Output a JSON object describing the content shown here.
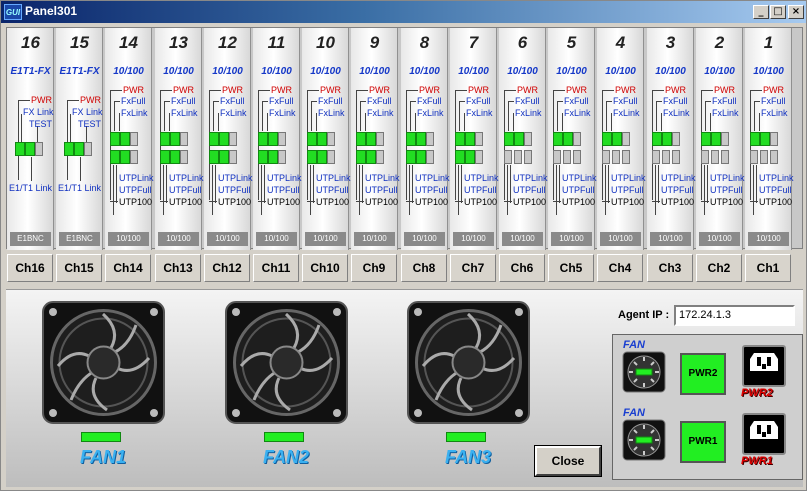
{
  "window": {
    "title": "Panel301",
    "icon_text": "GUI",
    "controls": [
      "_",
      "□",
      "×"
    ]
  },
  "channels": [
    {
      "num": "16",
      "type": "E1T1-FX",
      "kind": "e1",
      "lines": [
        "PWR",
        "FX Link",
        "TEST"
      ],
      "bottom": "E1/T1 Link",
      "foot": "E1BNC",
      "ch": "Ch16"
    },
    {
      "num": "15",
      "type": "E1T1-FX",
      "kind": "e1",
      "lines": [
        "PWR",
        "FX Link",
        "TEST"
      ],
      "bottom": "E1/T1 Link",
      "foot": "E1BNC",
      "ch": "Ch15"
    },
    {
      "num": "14",
      "type": "10/100",
      "kind": "eth",
      "lines": [
        "PWR",
        "FxFull",
        "FxLink",
        "UTPLink",
        "UTPFull",
        "UTP100"
      ],
      "foot": "10/100",
      "ch": "Ch14"
    },
    {
      "num": "13",
      "type": "10/100",
      "kind": "eth",
      "lines": [
        "PWR",
        "FxFull",
        "FxLink",
        "UTPLink",
        "UTPFull",
        "UTP100"
      ],
      "foot": "10/100",
      "ch": "Ch13"
    },
    {
      "num": "12",
      "type": "10/100",
      "kind": "eth",
      "lines": [
        "PWR",
        "FxFull",
        "FxLink",
        "UTPLink",
        "UTPFull",
        "UTP100"
      ],
      "foot": "10/100",
      "ch": "Ch12"
    },
    {
      "num": "11",
      "type": "10/100",
      "kind": "eth",
      "lines": [
        "PWR",
        "FxFull",
        "FxLink",
        "UTPLink",
        "UTPFull",
        "UTP100"
      ],
      "foot": "10/100",
      "ch": "Ch11"
    },
    {
      "num": "10",
      "type": "10/100",
      "kind": "eth",
      "lines": [
        "PWR",
        "FxFull",
        "FxLink",
        "UTPLink",
        "UTPFull",
        "UTP100"
      ],
      "foot": "10/100",
      "ch": "Ch10"
    },
    {
      "num": "9",
      "type": "10/100",
      "kind": "eth",
      "lines": [
        "PWR",
        "FxFull",
        "FxLink",
        "UTPLink",
        "UTPFull",
        "UTP100"
      ],
      "foot": "10/100",
      "ch": "Ch9"
    },
    {
      "num": "8",
      "type": "10/100",
      "kind": "eth",
      "lines": [
        "PWR",
        "FxFull",
        "FxLink",
        "UTPLink",
        "UTPFull",
        "UTP100"
      ],
      "foot": "10/100",
      "ch": "Ch8"
    },
    {
      "num": "7",
      "type": "10/100",
      "kind": "eth",
      "lines": [
        "PWR",
        "FxFull",
        "FxLink",
        "UTPLink",
        "UTPFull",
        "UTP100"
      ],
      "foot": "10/100",
      "ch": "Ch7"
    },
    {
      "num": "6",
      "type": "10/100",
      "kind": "eth",
      "lines": [
        "PWR",
        "FxFull",
        "FxLink",
        "UTPLink",
        "UTPFull",
        "UTP100"
      ],
      "foot": "10/100",
      "ch": "Ch6"
    },
    {
      "num": "5",
      "type": "10/100",
      "kind": "eth",
      "lines": [
        "PWR",
        "FxFull",
        "FxLink",
        "UTPLink",
        "UTPFull",
        "UTP100"
      ],
      "foot": "10/100",
      "ch": "Ch5"
    },
    {
      "num": "4",
      "type": "10/100",
      "kind": "eth",
      "lines": [
        "PWR",
        "FxFull",
        "FxLink",
        "UTPLink",
        "UTPFull",
        "UTP100"
      ],
      "foot": "10/100",
      "ch": "Ch4"
    },
    {
      "num": "3",
      "type": "10/100",
      "kind": "eth",
      "lines": [
        "PWR",
        "FxFull",
        "FxLink",
        "UTPLink",
        "UTPFull",
        "UTP100"
      ],
      "foot": "10/100",
      "ch": "Ch3"
    },
    {
      "num": "2",
      "type": "10/100",
      "kind": "eth",
      "lines": [
        "PWR",
        "FxFull",
        "FxLink",
        "UTPLink",
        "UTPFull",
        "UTP100"
      ],
      "foot": "10/100",
      "ch": "Ch2"
    },
    {
      "num": "1",
      "type": "10/100",
      "kind": "eth",
      "lines": [
        "PWR",
        "FxFull",
        "FxLink",
        "UTPLink",
        "UTPFull",
        "UTP100"
      ],
      "foot": "10/100",
      "ch": "Ch1"
    }
  ],
  "fans": [
    {
      "label": "FAN1",
      "led": "on"
    },
    {
      "label": "FAN2",
      "led": "on"
    },
    {
      "label": "FAN3",
      "led": "on"
    }
  ],
  "agent": {
    "label": "Agent IP :",
    "ip": "172.24.1.3"
  },
  "power": [
    {
      "fan_label": "FAN",
      "psu": "PWR2",
      "plug_label": "PWR2"
    },
    {
      "fan_label": "FAN",
      "psu": "PWR1",
      "plug_label": "PWR1"
    }
  ],
  "close_label": "Close",
  "colors": {
    "led_on": "#22ee22",
    "led_off": "#c8c8c8",
    "pwr_label": "#d00000",
    "link_label": "#1030c0",
    "fan_label": "#3ab0f0"
  }
}
